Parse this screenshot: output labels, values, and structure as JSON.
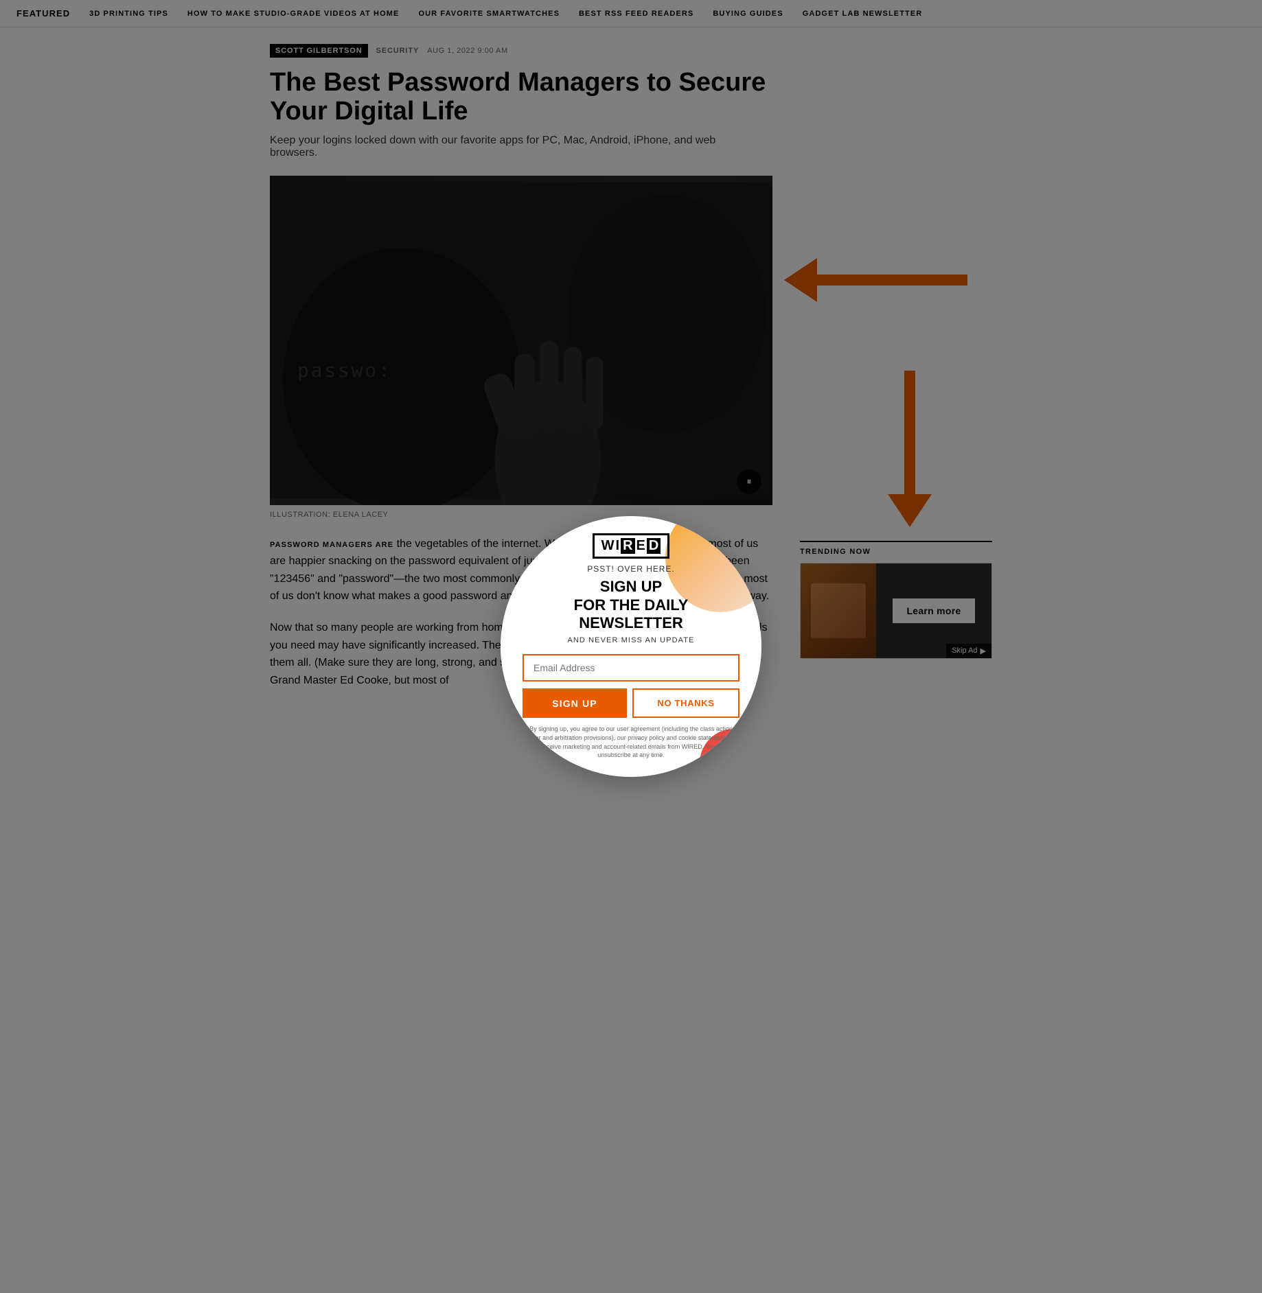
{
  "nav": {
    "featured": "FEATURED",
    "links": [
      "3D PRINTING TIPS",
      "HOW TO MAKE STUDIO-GRADE VIDEOS AT HOME",
      "OUR FAVORITE SMARTWATCHES",
      "BEST RSS FEED READERS",
      "BUYING GUIDES",
      "GADGET LAB NEWSLETTER"
    ]
  },
  "article": {
    "author": "SCOTT GILBERTSON",
    "category": "SECURITY",
    "date": "AUG 1, 2022 9:00 AM",
    "title": "The Best Password Managers to Secure Your Digital Life",
    "subtitle": "Keep your logins locked down with our favorite apps for PC, Mac, Android, iPhone, and web browsers.",
    "image_caption": "ILLUSTRATION: ELENA LACEY",
    "password_overlay": "passwo:",
    "body_p1_caps": "PASSWORD MANAGERS ARE",
    "body_p1": " the vegetables of the internet. We know they're good for us, but most of us are happier snacking on the password equivalent of junk food. For seven years running that's been \"123456\" and \"password\"—the two most commonly used passwords on the web. The problem is, most of us don't know what makes a good password and aren't able to remember hundreds of them anyway.",
    "body_p2": "Now that so many people are working from home, outside the office intranet, the number of passwords you need may have significantly increased. The safest (if craziest!) way to store them is to memorize them all. (Make sure they are long, strong, and secure!) Just kidding. That might work for Memory Grand Master Ed Cooke, but most of"
  },
  "sidebar": {
    "trending_label": "TRENDING NOW",
    "ad_learn_more": "Learn more",
    "ad_skip": "Skip Ad"
  },
  "modal": {
    "logo_text": "WIRED",
    "psst": "PSST! OVER HERE.",
    "headline_line1": "SIGN UP",
    "headline_line2": "FOR THE DAILY",
    "headline_line3": "NEWSLETTER",
    "subline": "AND NEVER MISS AN UPDATE",
    "email_placeholder": "Email Address",
    "btn_signup": "SIGN UP",
    "btn_nothanks": "NO THANKS",
    "fine_print": "By signing up, you agree to our user agreement (including the class action waiver and arbitration provisions), our privacy policy and cookie statement, and to receive marketing and account-related emails from WIRED. You can unsubscribe at any time."
  }
}
